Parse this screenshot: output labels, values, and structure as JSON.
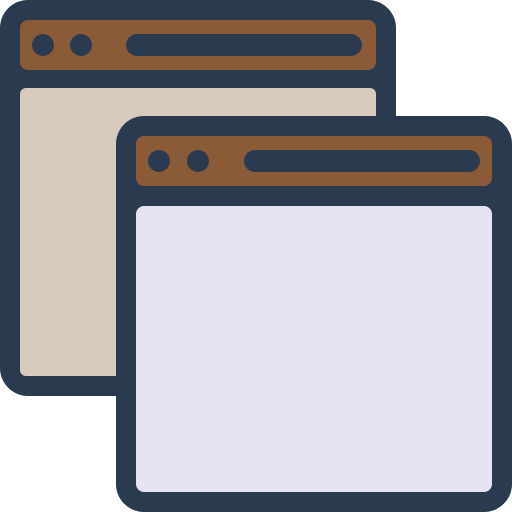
{
  "icon": {
    "name": "multiple-browser-windows-icon",
    "colors": {
      "outline": "#2a3b50",
      "title_bar": "#8b5a36",
      "back_window_body": "#d8cbbe",
      "front_window_body": "#e6e4f3",
      "background": "#ffffff"
    }
  }
}
